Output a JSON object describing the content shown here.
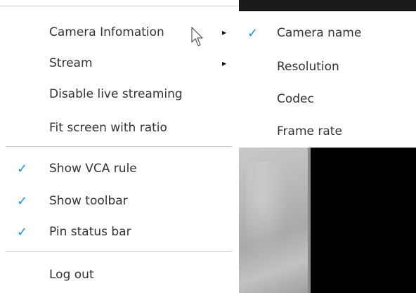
{
  "menu": {
    "items": [
      {
        "label": "Camera Infomation",
        "checked": false,
        "submenu_arrow": "▸"
      },
      {
        "label": "Stream",
        "checked": false,
        "submenu_arrow": "▸"
      },
      {
        "label": "Disable live streaming",
        "checked": false
      },
      {
        "label": "Fit screen with ratio",
        "checked": false
      },
      {
        "label": "Show VCA rule",
        "checked": true
      },
      {
        "label": "Show toolbar",
        "checked": true
      },
      {
        "label": "Pin status bar",
        "checked": true
      },
      {
        "label": "Log out",
        "checked": false
      }
    ],
    "check_glyph": "✓"
  },
  "submenu": {
    "items": [
      {
        "label": "Camera name",
        "checked": true
      },
      {
        "label": "Resolution",
        "checked": false
      },
      {
        "label": "Codec",
        "checked": false
      },
      {
        "label": "Frame rate",
        "checked": false
      }
    ],
    "check_glyph": "✓"
  },
  "colors": {
    "accent": "#1c8ee8",
    "text": "#333333",
    "separator": "#c8c8c8"
  },
  "icons": {
    "cursor": "mouse-pointer-icon",
    "arrow": "chevron-right-icon",
    "check": "checkmark-icon"
  }
}
